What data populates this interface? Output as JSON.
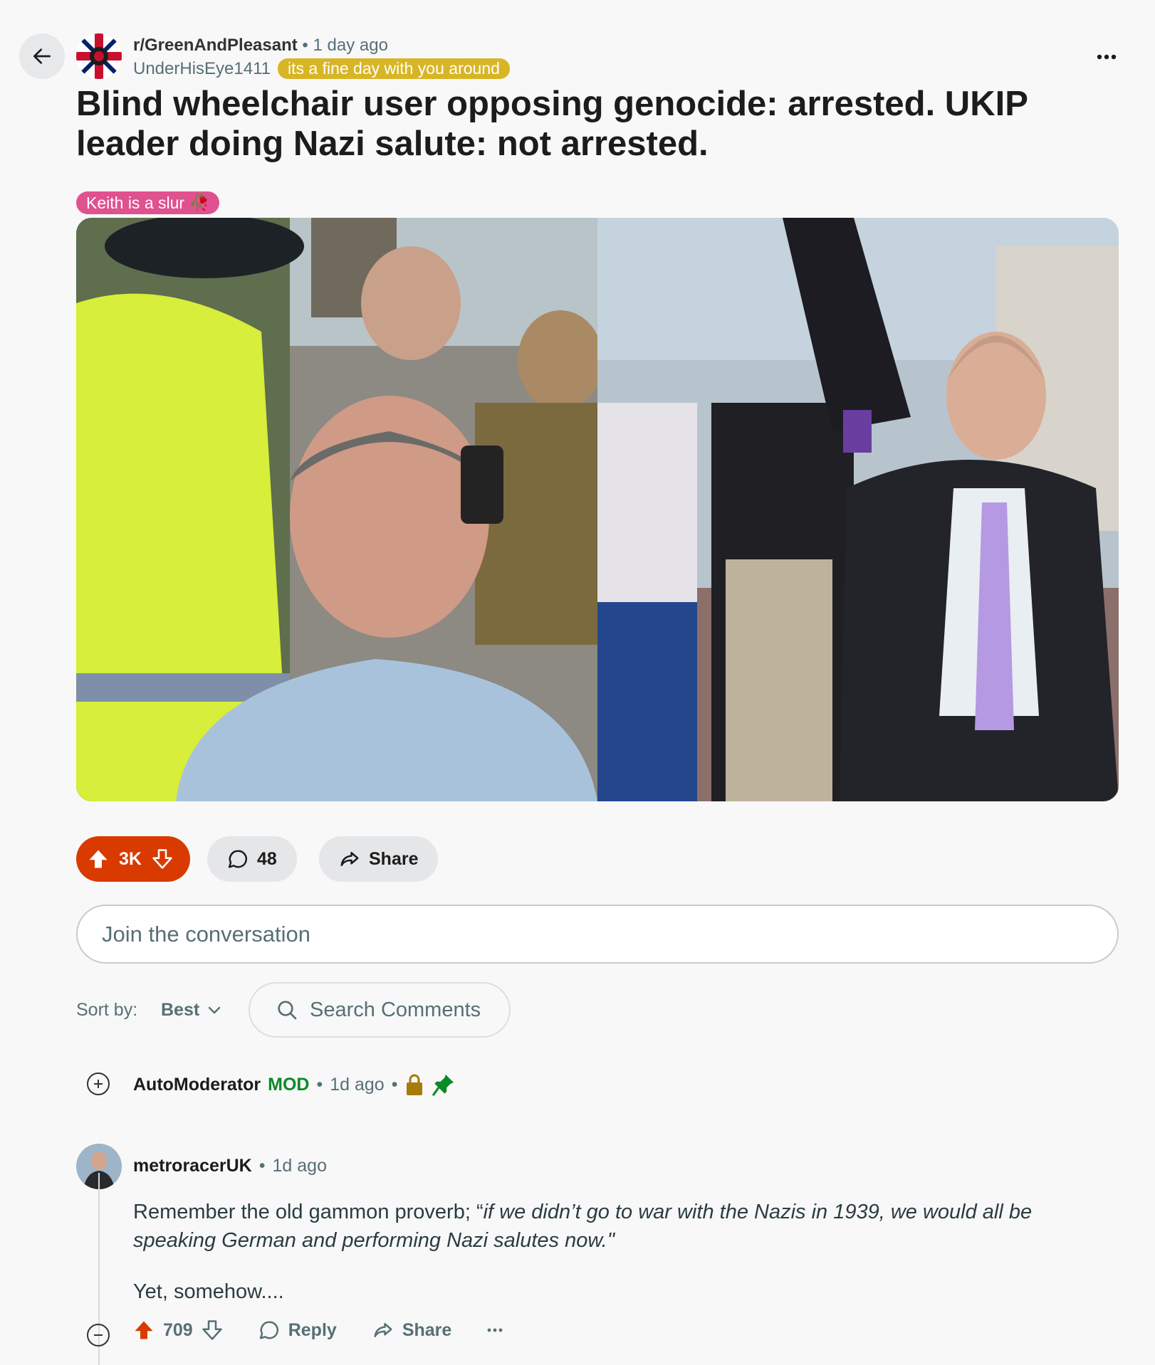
{
  "post": {
    "subreddit": "r/GreenAndPleasant",
    "time": "1 day ago",
    "author": "UnderHisEye1411",
    "user_flair": "its a fine day with you around",
    "title": "Blind wheelchair user opposing genocide: arrested. UKIP leader doing Nazi salute: not arrested.",
    "post_flair": "Keith is a slur 🥀",
    "votes": "3K",
    "comments": "48",
    "share_label": "Share"
  },
  "composer": {
    "placeholder": "Join the conversation"
  },
  "sort": {
    "label": "Sort by:",
    "value": "Best",
    "search_placeholder": "Search Comments"
  },
  "comments": [
    {
      "username": "AutoModerator",
      "tag": "MOD",
      "time": "1d ago"
    },
    {
      "username": "metroracerUK",
      "time": "1d ago",
      "body_prefix": "Remember the old gammon proverb; “",
      "body_quote": "if we didn’t go to war with the Nazis in 1939, we would all be speaking German and performing Nazi salutes now.\"",
      "body_second": "Yet, somehow....",
      "votes": "709",
      "reply_label": "Reply",
      "share_label": "Share"
    }
  ],
  "colors": {
    "upvote": "#d93a00",
    "mod": "#0a8a28",
    "user_flair": "#d8b525",
    "post_flair": "#e0518f"
  }
}
